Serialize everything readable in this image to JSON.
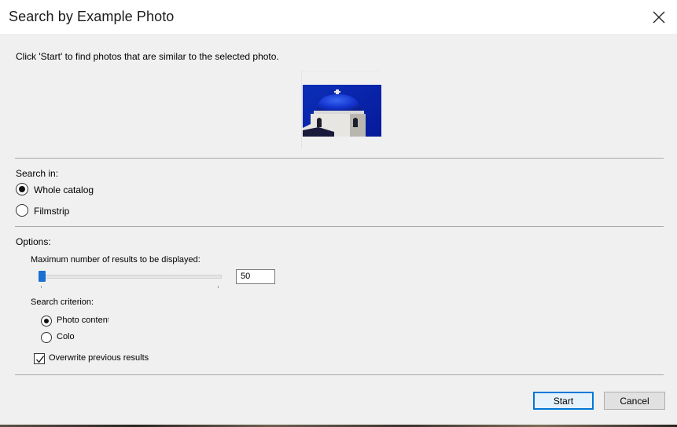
{
  "dialog": {
    "title": "Search by Example Photo",
    "instruction": "Click 'Start' to find photos that are similar to the selected photo."
  },
  "search_in": {
    "label": "Search in:",
    "options": [
      {
        "label": "Whole catalog",
        "selected": true
      },
      {
        "label": "Filmstrip",
        "selected": false
      }
    ]
  },
  "options": {
    "label": "Options:",
    "max_results": {
      "label": "Maximum number of results to be displayed:",
      "value": "50"
    },
    "criterion": {
      "label": "Search criterion:",
      "options": [
        {
          "label": "Photo content",
          "selected": true
        },
        {
          "label": "Color",
          "selected": false
        }
      ]
    },
    "overwrite": {
      "label": "Overwrite previous results",
      "checked": true
    }
  },
  "buttons": {
    "start": "Start",
    "cancel": "Cancel"
  },
  "colors": {
    "accent": "#0078d7",
    "slider": "#1a6fd1",
    "dome_blue": "#1a3fd8"
  }
}
